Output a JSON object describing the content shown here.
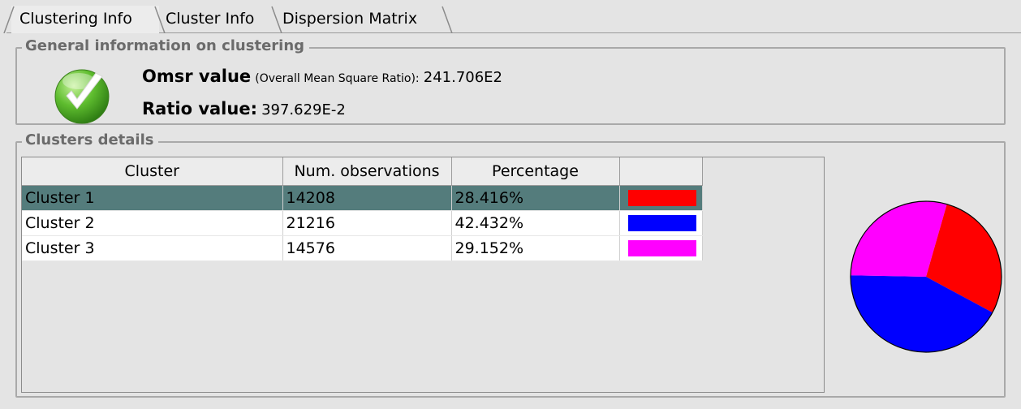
{
  "tabs": [
    {
      "label": "Clustering Info",
      "active": true
    },
    {
      "label": "Cluster Info",
      "active": false
    },
    {
      "label": "Dispersion Matrix",
      "active": false
    }
  ],
  "general": {
    "title": "General information on clustering",
    "omsr_label": "Omsr value",
    "omsr_sub": "(Overall Mean Square Ratio):",
    "omsr_value": "241.706E2",
    "ratio_label": "Ratio value:",
    "ratio_value": "397.629E-2",
    "status_icon": "checkmark-icon"
  },
  "clusters": {
    "title": "Clusters details",
    "columns": [
      "Cluster",
      "Num. observations",
      "Percentage",
      ""
    ],
    "rows": [
      {
        "name": "Cluster 1",
        "count": "14208",
        "percentage": "28.416%",
        "color": "#ff0000",
        "selected": true
      },
      {
        "name": "Cluster 2",
        "count": "21216",
        "percentage": "42.432%",
        "color": "#0000ff",
        "selected": false
      },
      {
        "name": "Cluster 3",
        "count": "14576",
        "percentage": "29.152%",
        "color": "#ff00ff",
        "selected": false
      }
    ]
  },
  "chart_data": {
    "type": "pie",
    "categories": [
      "Cluster 1",
      "Cluster 2",
      "Cluster 3"
    ],
    "values": [
      28.416,
      42.432,
      29.152
    ],
    "colors": [
      "#ff0000",
      "#0000ff",
      "#ff00ff"
    ]
  }
}
